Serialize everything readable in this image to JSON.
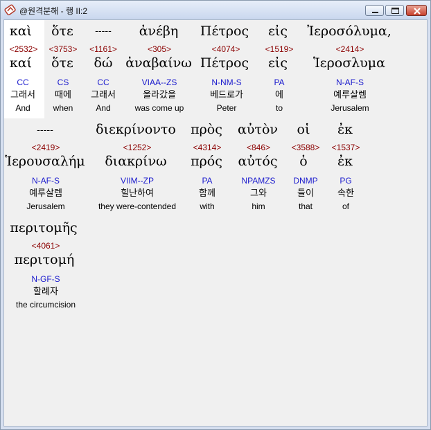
{
  "window": {
    "title": "@원격분해 - 행 II:2"
  },
  "rows": [
    {
      "words": [
        {
          "surface": "καὶ",
          "strong": "<2532>",
          "lemma": "καί",
          "parse": "CC",
          "korean": "그래서",
          "english": "And"
        },
        {
          "surface": "ὅτε",
          "strong": "<3753>",
          "lemma": "ὅτε",
          "parse": "CS",
          "korean": "때에",
          "english": "when"
        },
        {
          "surface": "-----",
          "strong": "<1161>",
          "lemma": "δώ",
          "parse": "CC",
          "korean": "그래서",
          "english": "And"
        },
        {
          "surface": "ἀνέβη",
          "strong": "<305>",
          "lemma": "ἀναβαίνω",
          "parse": "VIAA--ZS",
          "korean": "올라갔을",
          "english": "was come up"
        },
        {
          "surface": "Πέτρος",
          "strong": "<4074>",
          "lemma": "Πέτρος",
          "parse": "N-NM-S",
          "korean": "베드로가",
          "english": "Peter"
        },
        {
          "surface": "εἰς",
          "strong": "<1519>",
          "lemma": "εἰς",
          "parse": "PA",
          "korean": "에",
          "english": "to"
        },
        {
          "surface": "Ἰεροσόλυμα,",
          "strong": "<2414>",
          "lemma": "Ἱεροσλυμα",
          "parse": "N-AF-S",
          "korean": "예루살렘",
          "english": "Jerusalem"
        }
      ]
    },
    {
      "words": [
        {
          "surface": "-----",
          "strong": "<2419>",
          "lemma": "Ἱερουσαλήμ",
          "parse": "N-AF-S",
          "korean": "예루살렘",
          "english": "Jerusalem"
        },
        {
          "surface": "διεκρίνοντο",
          "strong": "<1252>",
          "lemma": "διακρίνω",
          "parse": "VIIM--ZP",
          "korean": "힐난하여",
          "english": "they were-contended"
        },
        {
          "surface": "πρὸς",
          "strong": "<4314>",
          "lemma": "πρός",
          "parse": "PA",
          "korean": "함께",
          "english": "with"
        },
        {
          "surface": "αὐτὸν",
          "strong": "<846>",
          "lemma": "αὐτός",
          "parse": "NPAMZS",
          "korean": "그와",
          "english": "him"
        },
        {
          "surface": "οἱ",
          "strong": "<3588>",
          "lemma": "ὁ",
          "parse": "DNMP",
          "korean": "들이",
          "english": "that"
        },
        {
          "surface": "ἐκ",
          "strong": "<1537>",
          "lemma": "ἐκ",
          "parse": "PG",
          "korean": "속한",
          "english": "of"
        }
      ]
    },
    {
      "words": [
        {
          "surface": "περιτομῆς",
          "strong": "<4061>",
          "lemma": "περιτομή",
          "parse": "N-GF-S",
          "korean": "할례자",
          "english": "the circumcision"
        }
      ]
    }
  ]
}
